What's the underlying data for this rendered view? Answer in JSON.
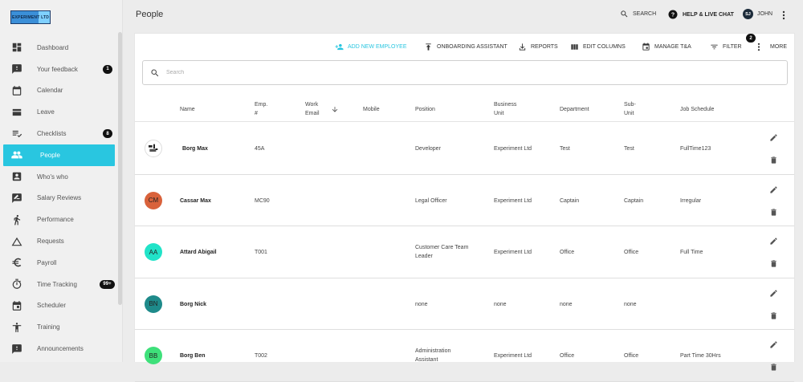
{
  "app": {
    "logo_text": "EXPERIMENT LTD",
    "page_title": "People"
  },
  "topbar": {
    "search_label": "SEARCH",
    "help_label": "HELP & LIVE CHAT",
    "user_initials": "SJ",
    "user_name": "JOHN"
  },
  "sidebar": {
    "items": [
      {
        "label": "Dashboard",
        "icon": "dashboard-icon",
        "badge": ""
      },
      {
        "label": "Your feedback",
        "icon": "feedback-icon",
        "badge": "1"
      },
      {
        "label": "Calendar",
        "icon": "calendar-icon",
        "badge": ""
      },
      {
        "label": "Leave",
        "icon": "leave-icon",
        "badge": ""
      },
      {
        "label": "Checklists",
        "icon": "checklist-icon",
        "badge": "8"
      },
      {
        "label": "People",
        "icon": "people-icon",
        "badge": "",
        "active": true
      },
      {
        "label": "Who's who",
        "icon": "contact-card-icon",
        "badge": ""
      },
      {
        "label": "Salary Reviews",
        "icon": "salary-review-icon",
        "badge": ""
      },
      {
        "label": "Performance",
        "icon": "performance-icon",
        "badge": ""
      },
      {
        "label": "Requests",
        "icon": "requests-icon",
        "badge": ""
      },
      {
        "label": "Payroll",
        "icon": "euro-icon",
        "badge": ""
      },
      {
        "label": "Time Tracking",
        "icon": "stopwatch-icon",
        "badge": "99+"
      },
      {
        "label": "Scheduler",
        "icon": "scheduler-icon",
        "badge": ""
      },
      {
        "label": "Training",
        "icon": "training-icon",
        "badge": ""
      },
      {
        "label": "Announcements",
        "icon": "announcement-icon",
        "badge": ""
      }
    ]
  },
  "toolbar": {
    "add_employee": "ADD NEW EMPLOYEE",
    "onboarding": "ONBOARDING ASSISTANT",
    "reports": "REPORTS",
    "edit_columns": "EDIT COLUMNS",
    "manage_ta": "MANAGE T&A",
    "filter": "FILTER",
    "filter_count": "2",
    "more": "MORE"
  },
  "search": {
    "placeholder": "Search",
    "value": ""
  },
  "table": {
    "headers": {
      "name": "Name",
      "emp_no_1": "Emp.",
      "emp_no_2": "#",
      "work_email_1": "Work",
      "work_email_2": "Email",
      "mobile": "Mobile",
      "position": "Position",
      "business_unit_1": "Business",
      "business_unit_2": "Unit",
      "department": "Department",
      "sub_unit_1": "Sub-",
      "sub_unit_2": "Unit",
      "job_schedule": "Job Schedule"
    },
    "rows": [
      {
        "initials": "",
        "avatar_color": "#ffffff",
        "name": "Borg Max",
        "emp_no": "45A",
        "email": "",
        "mobile": "",
        "position_1": "Developer",
        "position_2": "",
        "business_unit": "Experiment Ltd",
        "department": "Test",
        "sub_unit": "Test",
        "job_schedule": "FullTime123"
      },
      {
        "initials": "CM",
        "avatar_color": "#d9623b",
        "name": "Cassar Max",
        "emp_no": "MC90",
        "email": "",
        "mobile": "",
        "position_1": "Legal Officer",
        "position_2": "",
        "business_unit": "Experiment Ltd",
        "department": "Captain",
        "sub_unit": "Captain",
        "job_schedule": "Irregular"
      },
      {
        "initials": "AA",
        "avatar_color": "#21e3c8",
        "name": "Attard Abigail",
        "emp_no": "T001",
        "email": "",
        "mobile": "",
        "position_1": "Customer Care Team",
        "position_2": "Leader",
        "business_unit": "Experiment Ltd",
        "department": "Office",
        "sub_unit": "Office",
        "job_schedule": "Full Time"
      },
      {
        "initials": "BN",
        "avatar_color": "#1e8a8a",
        "name": "Borg Nick",
        "emp_no": "",
        "email": "",
        "mobile": "",
        "position_1": "none",
        "position_2": "",
        "business_unit": "none",
        "department": "none",
        "sub_unit": "none",
        "job_schedule": ""
      },
      {
        "initials": "BB",
        "avatar_color": "#3ee07a",
        "name": "Borg Ben",
        "emp_no": "T002",
        "email": "",
        "mobile": "",
        "position_1": "Administration",
        "position_2": "Assistant",
        "business_unit": "Experiment Ltd",
        "department": "Office",
        "sub_unit": "Office",
        "job_schedule": "Part Time 30Hrs"
      }
    ]
  },
  "colors": {
    "accent": "#29c6e0",
    "badge": "#111111"
  }
}
